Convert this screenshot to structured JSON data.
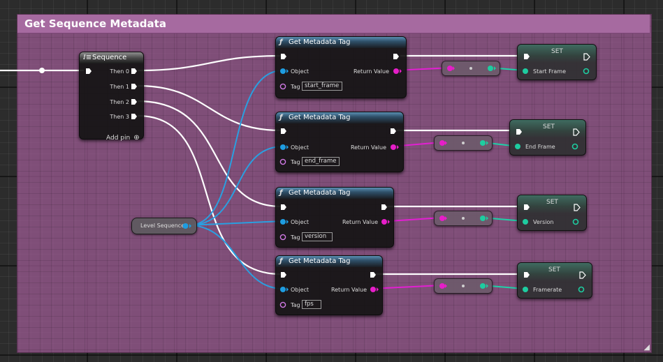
{
  "comment": {
    "title": "Get Sequence Metadata"
  },
  "sequence_node": {
    "title": "Sequence",
    "outputs": [
      "Then 0",
      "Then 1",
      "Then 2",
      "Then 3"
    ],
    "add_pin_label": "Add pin"
  },
  "variable_node": {
    "label": "Level Sequence"
  },
  "metadata_nodes": [
    {
      "title": "Get Metadata Tag",
      "object_label": "Object",
      "return_label": "Return Value",
      "tag_label": "Tag",
      "tag_value": "start_frame"
    },
    {
      "title": "Get Metadata Tag",
      "object_label": "Object",
      "return_label": "Return Value",
      "tag_label": "Tag",
      "tag_value": "end_frame"
    },
    {
      "title": "Get Metadata Tag",
      "object_label": "Object",
      "return_label": "Return Value",
      "tag_label": "Tag",
      "tag_value": "version"
    },
    {
      "title": "Get Metadata Tag",
      "object_label": "Object",
      "return_label": "Return Value",
      "tag_label": "Tag",
      "tag_value": "fps"
    }
  ],
  "set_nodes": [
    {
      "title": "SET",
      "variable": "Start Frame"
    },
    {
      "title": "SET",
      "variable": "End Frame"
    },
    {
      "title": "SET",
      "variable": "Version"
    },
    {
      "title": "SET",
      "variable": "Framerate"
    }
  ],
  "colors": {
    "comment_bg": "#a05c96",
    "exec_wire": "#ffffff",
    "object_pin": "#1e9ce0",
    "string_pin": "#e61ec8",
    "variable_pin": "#1ecca0",
    "node_header": "#4a7da0"
  }
}
